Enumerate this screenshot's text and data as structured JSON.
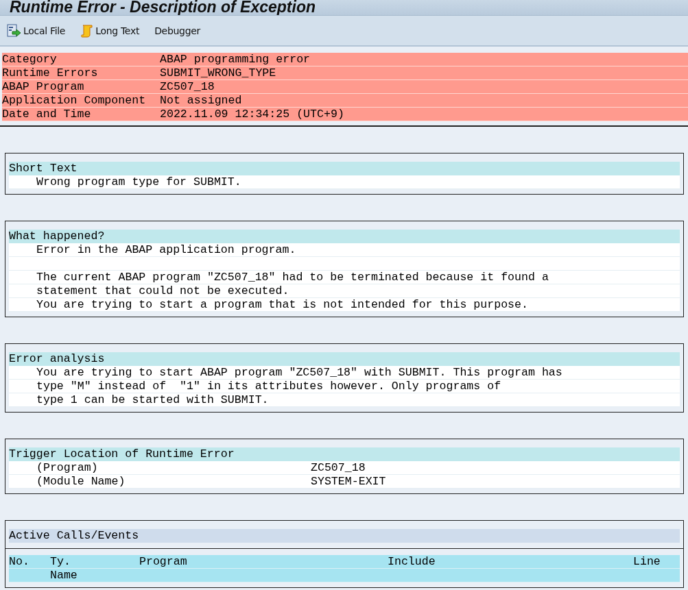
{
  "window": {
    "title": "Runtime Error - Description of Exception"
  },
  "toolbar": [
    "Local File",
    "Long Text",
    "Debugger"
  ],
  "header": [
    {
      "label": "Category",
      "value": "ABAP programming error"
    },
    {
      "label": "Runtime Errors",
      "value": "SUBMIT_WRONG_TYPE"
    },
    {
      "label": "ABAP Program",
      "value": "ZC507_18"
    },
    {
      "label": "Application Component",
      "value": "Not assigned"
    },
    {
      "label": "Date and Time",
      "value": "2022.11.09 12:34:25 (UTC+9)"
    }
  ],
  "sections": [
    {
      "kind": "text",
      "title": "Short Text",
      "lines": [
        {
          "kind": "text",
          "text": "Wrong program type for SUBMIT."
        }
      ]
    },
    {
      "kind": "text",
      "title": "What happened?",
      "lines": [
        {
          "kind": "text",
          "text": "Error in the ABAP application program."
        },
        {
          "kind": "blank"
        },
        {
          "kind": "text",
          "text": "The current ABAP program \"ZC507_18\" had to be terminated because it found a"
        },
        {
          "kind": "text",
          "text": "statement that could not be executed."
        },
        {
          "kind": "text",
          "text": "You are trying to start a program that is not intended for this purpose."
        }
      ]
    },
    {
      "kind": "text",
      "title": "Error analysis",
      "lines": [
        {
          "kind": "text",
          "text": "You are trying to start ABAP program \"ZC507_18\" with SUBMIT. This program has"
        },
        {
          "kind": "text",
          "text": "type \"M\" instead of  \"1\" in its attributes however. Only programs of"
        },
        {
          "kind": "text",
          "text": "type 1 can be started with SUBMIT."
        }
      ]
    },
    {
      "kind": "pairs",
      "title": "Trigger Location of Runtime Error",
      "pairs": [
        {
          "label": "(Program)",
          "value": "ZC507_18"
        },
        {
          "label": "(Module Name)",
          "value": "SYSTEM-EXIT"
        }
      ]
    },
    {
      "kind": "table",
      "title": "Active Calls/Events",
      "columns": [
        "No.",
        "Ty.",
        "Program",
        "Include",
        "Line"
      ],
      "subcolumns": [
        "Name"
      ]
    }
  ]
}
